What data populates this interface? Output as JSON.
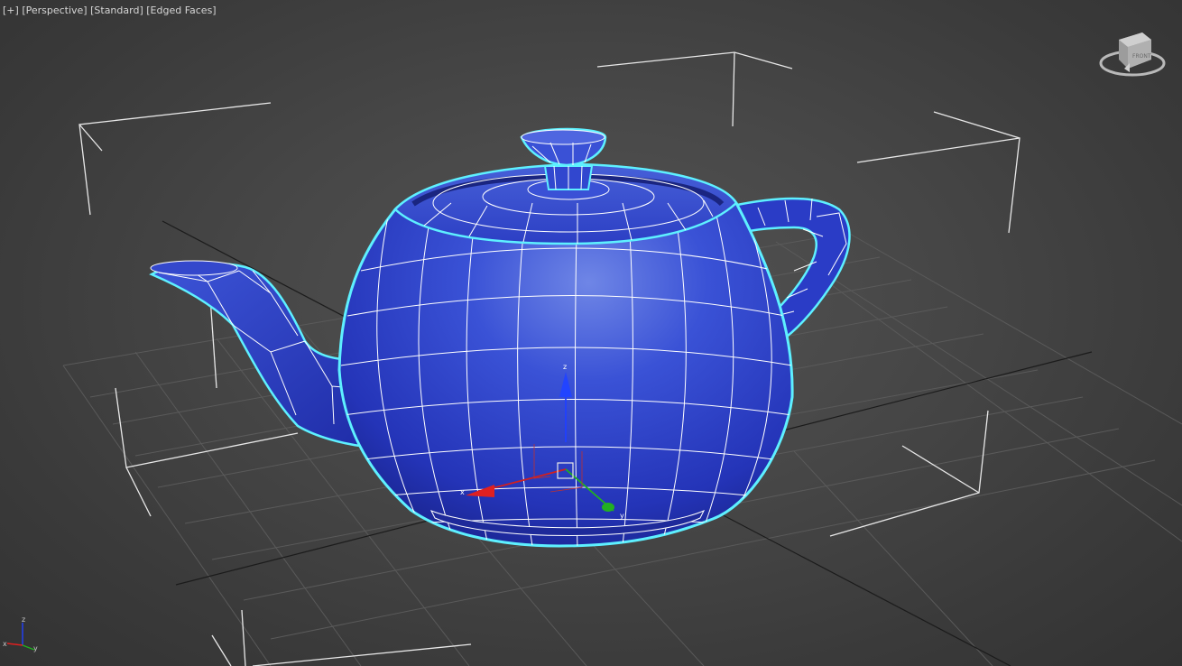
{
  "viewport": {
    "menu": {
      "plus_label": "[+]",
      "view_label": "[Perspective]",
      "shading_label": "[Standard]",
      "display_label": "[Edged Faces]"
    },
    "view_cube": {
      "face_label": "FRONT"
    },
    "gizmo": {
      "x_label": "x",
      "y_label": "y",
      "z_label": "z"
    },
    "axis_tripod": {
      "x_label": "x",
      "y_label": "y",
      "z_label": "z"
    },
    "object": {
      "name": "Teapot",
      "color": "#2b3bc9",
      "selection_color": "#5ef0ff",
      "wire_color": "#ffffff"
    },
    "colors": {
      "x_axis": "#e02020",
      "y_axis": "#20b020",
      "z_axis": "#2040ff",
      "grid": "#5a5a5a",
      "grid_major": "#1a1a1a"
    }
  }
}
